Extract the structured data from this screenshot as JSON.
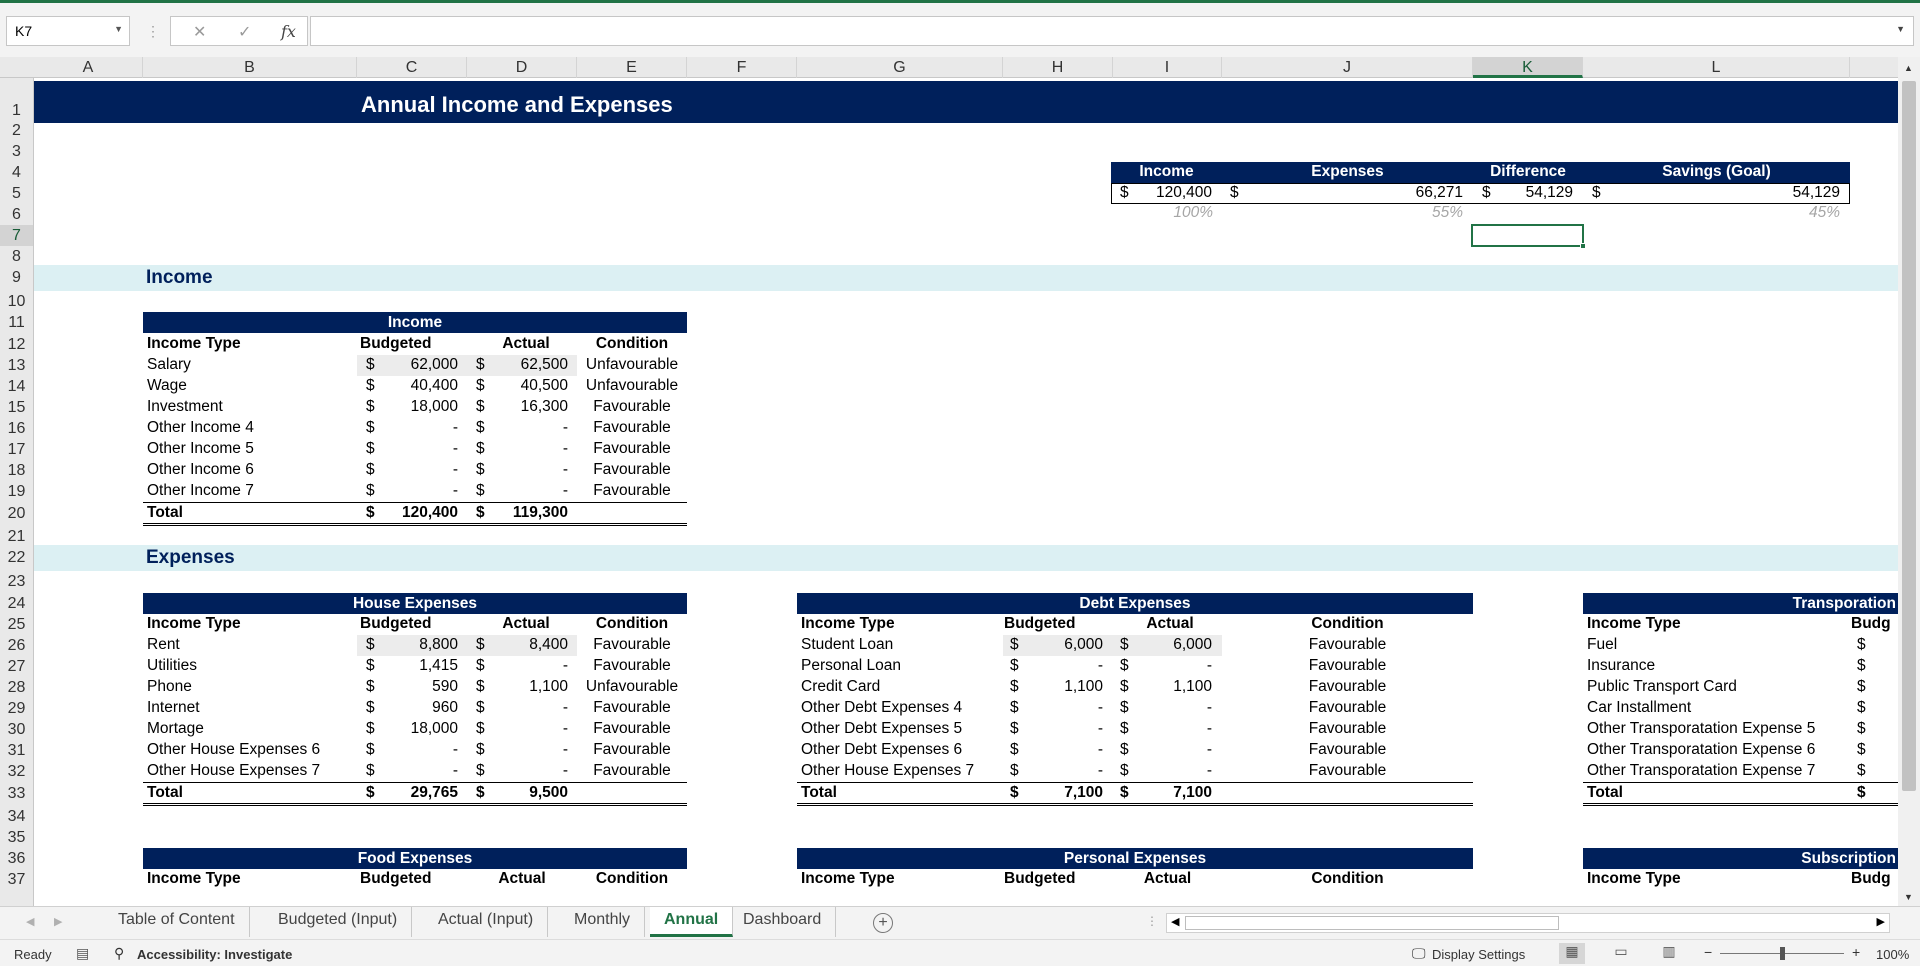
{
  "formula_bar": {
    "name_box": "K7",
    "fx": "fx",
    "formula": ""
  },
  "columns": [
    "A",
    "B",
    "C",
    "D",
    "E",
    "F",
    "G",
    "H",
    "I",
    "J",
    "K",
    "L"
  ],
  "rows": [
    "1",
    "2",
    "3",
    "4",
    "5",
    "6",
    "7",
    "8",
    "9",
    "10",
    "11",
    "12",
    "13",
    "14",
    "15",
    "16",
    "17",
    "18",
    "19",
    "20",
    "21",
    "22",
    "23",
    "24",
    "25",
    "26",
    "27",
    "28",
    "29",
    "30",
    "31",
    "32",
    "33",
    "34",
    "35",
    "36",
    "37"
  ],
  "title": "Annual Income and Expenses",
  "summary": {
    "headers": [
      "Income",
      "Expenses",
      "Difference",
      "Savings (Goal)"
    ],
    "currency": "$",
    "income": "120,400",
    "expenses": "66,271",
    "difference": "54,129",
    "savings": "54,129",
    "pct_income": "100%",
    "pct_expenses": "55%",
    "pct_savings": "45%"
  },
  "sections": {
    "income": "Income",
    "expenses": "Expenses"
  },
  "col_headers": {
    "type": "Income Type",
    "budgeted": "Budgeted",
    "actual": "Actual",
    "condition": "Condition"
  },
  "income_table": {
    "title": "Income",
    "rows": [
      {
        "name": "Salary",
        "budgeted": "62,000",
        "actual": "62,500",
        "condition": "Unfavourable"
      },
      {
        "name": "Wage",
        "budgeted": "40,400",
        "actual": "40,500",
        "condition": "Unfavourable"
      },
      {
        "name": "Investment",
        "budgeted": "18,000",
        "actual": "16,300",
        "condition": "Favourable"
      },
      {
        "name": "Other Income 4",
        "budgeted": "-",
        "actual": "-",
        "condition": "Favourable"
      },
      {
        "name": "Other Income 5",
        "budgeted": "-",
        "actual": "-",
        "condition": "Favourable"
      },
      {
        "name": "Other Income 6",
        "budgeted": "-",
        "actual": "-",
        "condition": "Favourable"
      },
      {
        "name": "Other Income 7",
        "budgeted": "-",
        "actual": "-",
        "condition": "Favourable"
      }
    ],
    "total": {
      "label": "Total",
      "budgeted": "120,400",
      "actual": "119,300"
    }
  },
  "house_table": {
    "title": "House Expenses",
    "rows": [
      {
        "name": "Rent",
        "budgeted": "8,800",
        "actual": "8,400",
        "condition": "Favourable"
      },
      {
        "name": "Utilities",
        "budgeted": "1,415",
        "actual": "-",
        "condition": "Favourable"
      },
      {
        "name": "Phone",
        "budgeted": "590",
        "actual": "1,100",
        "condition": "Unfavourable"
      },
      {
        "name": "Internet",
        "budgeted": "960",
        "actual": "-",
        "condition": "Favourable"
      },
      {
        "name": "Mortage",
        "budgeted": "18,000",
        "actual": "-",
        "condition": "Favourable"
      },
      {
        "name": "Other House Expenses 6",
        "budgeted": "-",
        "actual": "-",
        "condition": "Favourable"
      },
      {
        "name": "Other House Expenses 7",
        "budgeted": "-",
        "actual": "-",
        "condition": "Favourable"
      }
    ],
    "total": {
      "label": "Total",
      "budgeted": "29,765",
      "actual": "9,500"
    }
  },
  "debt_table": {
    "title": "Debt Expenses",
    "rows": [
      {
        "name": "Student Loan",
        "budgeted": "6,000",
        "actual": "6,000",
        "condition": "Favourable"
      },
      {
        "name": "Personal Loan",
        "budgeted": "-",
        "actual": "-",
        "condition": "Favourable"
      },
      {
        "name": "Credit Card",
        "budgeted": "1,100",
        "actual": "1,100",
        "condition": "Favourable"
      },
      {
        "name": "Other Debt Expenses 4",
        "budgeted": "-",
        "actual": "-",
        "condition": "Favourable"
      },
      {
        "name": "Other Debt Expenses 5",
        "budgeted": "-",
        "actual": "-",
        "condition": "Favourable"
      },
      {
        "name": "Other Debt Expenses 6",
        "budgeted": "-",
        "actual": "-",
        "condition": "Favourable"
      },
      {
        "name": "Other House Expenses 7",
        "budgeted": "-",
        "actual": "-",
        "condition": "Favourable"
      }
    ],
    "total": {
      "label": "Total",
      "budgeted": "7,100",
      "actual": "7,100"
    }
  },
  "transport_table": {
    "title": "Transporation",
    "budgeted_partial": "Budg",
    "rows": [
      {
        "name": "Fuel"
      },
      {
        "name": "Insurance"
      },
      {
        "name": "Public Transport Card"
      },
      {
        "name": "Car Installment"
      },
      {
        "name": "Other Transporatation Expense 5"
      },
      {
        "name": "Other Transporatation Expense 6"
      },
      {
        "name": "Other Transporatation Expense 7"
      }
    ],
    "total": {
      "label": "Total"
    }
  },
  "food_table": {
    "title": "Food Expenses"
  },
  "personal_table": {
    "title": "Personal Expenses"
  },
  "subscription_table": {
    "title": "Subscription",
    "budgeted_partial": "Budg"
  },
  "sheet_tabs": [
    "Table of Content",
    "Budgeted (Input)",
    "Actual (Input)",
    "Monthly",
    "Annual",
    "Dashboard"
  ],
  "active_tab": "Annual",
  "status_bar": {
    "ready": "Ready",
    "accessibility": "Accessibility: Investigate",
    "display_settings": "Display Settings",
    "zoom": "100%",
    "zoom_level": 1.0
  },
  "colors": {
    "navy": "#00205b",
    "section_bg": "#dcf0f3",
    "excel_green": "#217346"
  }
}
